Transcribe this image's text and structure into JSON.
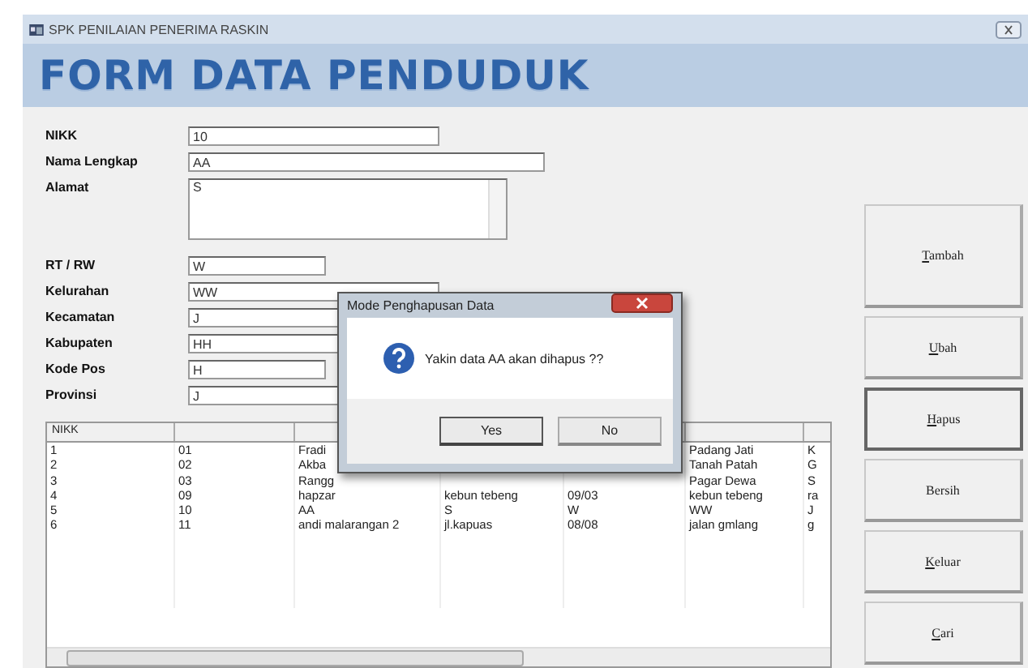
{
  "window": {
    "title": "SPK PENILAIAN PENERIMA RASKIN"
  },
  "banner": {
    "title": "FORM DATA PENDUDUK"
  },
  "form": {
    "fields": [
      {
        "label": "NIKK",
        "value": "10",
        "kind": "text"
      },
      {
        "label": "Nama Lengkap",
        "value": "AA",
        "kind": "text"
      },
      {
        "label": "Alamat",
        "value": "S",
        "kind": "memo"
      },
      {
        "label": "RT / RW",
        "value": "W",
        "kind": "text"
      },
      {
        "label": "Kelurahan",
        "value": "WW",
        "kind": "text"
      },
      {
        "label": "Kecamatan",
        "value": "J",
        "kind": "text"
      },
      {
        "label": "Kabupaten",
        "value": "HH",
        "kind": "text"
      },
      {
        "label": "Kode Pos",
        "value": "H",
        "kind": "text"
      },
      {
        "label": "Provinsi",
        "value": "J",
        "kind": "text"
      }
    ]
  },
  "table": {
    "columns": [
      "NIKK",
      "",
      "",
      "",
      "",
      "",
      ""
    ],
    "rows": [
      [
        "1",
        "01",
        "Fradi",
        "",
        "",
        "Padang Jati",
        "K"
      ],
      [
        "2",
        "02",
        "Akba",
        "",
        "",
        "Tanah Patah",
        "G"
      ],
      [
        "3",
        "03",
        "Rangg",
        "",
        "",
        "Pagar Dewa",
        "S"
      ],
      [
        "4",
        "09",
        "hapzar",
        "kebun tebeng",
        "09/03",
        "kebun tebeng",
        "ra"
      ],
      [
        "5",
        "10",
        "AA",
        "S",
        "W",
        "WW",
        "J"
      ],
      [
        "6",
        "11",
        "andi malarangan 2",
        "jl.kapuas",
        "08/08",
        "jalan gmlang",
        "g"
      ]
    ]
  },
  "buttons": [
    {
      "label": "Tambah",
      "underline_first": true,
      "focused": false
    },
    {
      "label": "Ubah",
      "underline_first": true,
      "focused": false
    },
    {
      "label": "Hapus",
      "underline_first": true,
      "focused": true
    },
    {
      "label": "Bersih",
      "underline_first": false,
      "focused": false
    },
    {
      "label": "Keluar",
      "underline_first": true,
      "focused": false
    },
    {
      "label": "Cari",
      "underline_first": true,
      "focused": false
    }
  ],
  "dialog": {
    "title": "Mode Penghapusan Data",
    "message": "Yakin data AA akan dihapus ??",
    "buttons": [
      {
        "label": "Yes",
        "focused": true
      },
      {
        "label": "No",
        "focused": false
      }
    ]
  }
}
